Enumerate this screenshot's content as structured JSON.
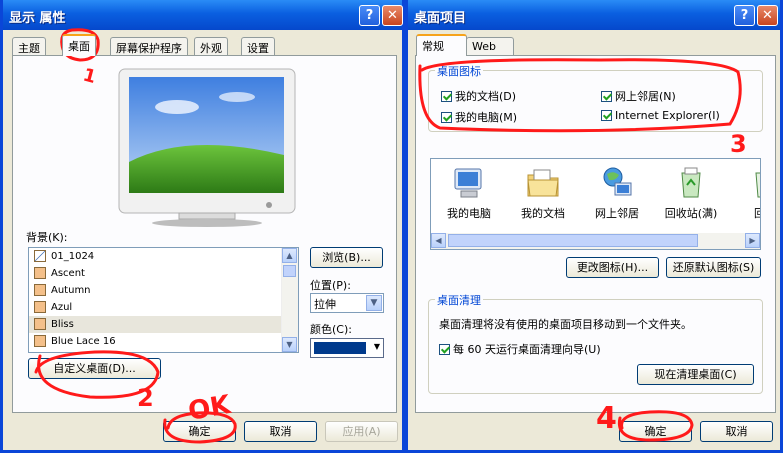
{
  "left_window": {
    "title": "显示 属性",
    "tabs": [
      "主题",
      "桌面",
      "屏幕保护程序",
      "外观",
      "设置"
    ],
    "background_label": "背景(K):",
    "backgrounds": [
      "01_1024",
      "Ascent",
      "Autumn",
      "Azul",
      "Bliss",
      "Blue Lace 16"
    ],
    "selected_background": "Bliss",
    "browse_button": "浏览(B)...",
    "position_label": "位置(P):",
    "position_value": "拉伸",
    "color_label": "颜色(C):",
    "color_value": "#003a8c",
    "customize_button": "自定义桌面(D)...",
    "ok_button": "确定",
    "cancel_button": "取消",
    "apply_button": "应用(A)"
  },
  "right_window": {
    "title": "桌面项目",
    "tabs": [
      "常规",
      "Web"
    ],
    "desktop_icons_group": "桌面图标",
    "checkboxes": {
      "my_documents": "我的文档(D)",
      "network": "网上邻居(N)",
      "my_computer": "我的电脑(M)",
      "ie": "Internet Explorer(I)"
    },
    "icons": [
      "我的电脑",
      "我的文档",
      "网上邻居",
      "回收站(满)",
      "回收"
    ],
    "change_icon_button": "更改图标(H)...",
    "restore_default_button": "还原默认图标(S)",
    "cleanup_group": "桌面清理",
    "cleanup_desc": "桌面清理将没有使用的桌面项目移动到一个文件夹。",
    "cleanup_checkbox": "每 60 天运行桌面清理向导(U)",
    "cleanup_now_button": "现在清理桌面(C)",
    "ok_button": "确定",
    "cancel_button": "取消"
  },
  "annotations": [
    "1",
    "2",
    "OK",
    "3",
    "4"
  ],
  "colors": {
    "title_blue": "#0a5fe0",
    "annotation_red": "#ff1a1a",
    "tab_highlight": "#f6a31b"
  }
}
